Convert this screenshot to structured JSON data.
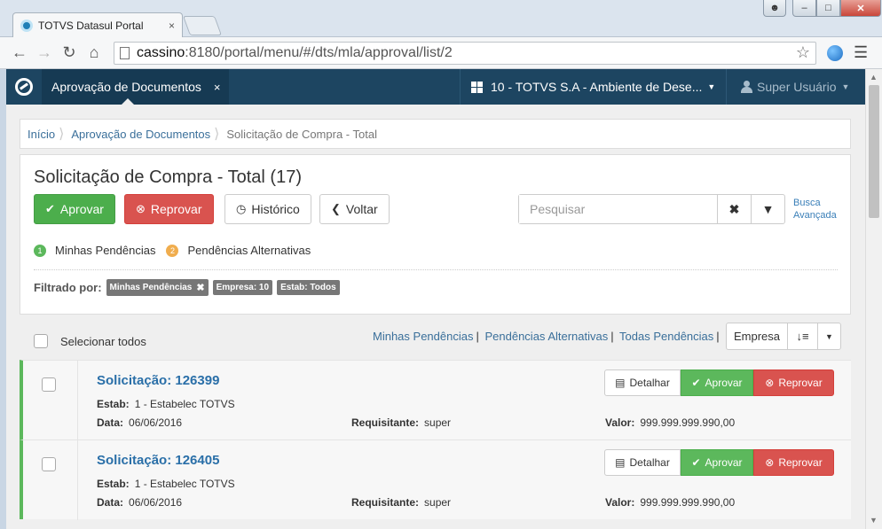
{
  "browser": {
    "tab_title": "TOTVS Datasul Portal",
    "tab_close": "×",
    "url_host": "cassino",
    "url_rest": ":8180/portal/menu/#/dts/mla/approval/list/2"
  },
  "appbar": {
    "active_tab": "Aprovação de Documentos",
    "tab_close": "×",
    "company": "10 - TOTVS S.A - Ambiente de Dese...",
    "user": "Super Usuário"
  },
  "breadcrumb": {
    "items": [
      "Início",
      "Aprovação de Documentos",
      "Solicitação de Compra - Total"
    ]
  },
  "panel": {
    "title": "Solicitação de Compra - Total (17)",
    "buttons": {
      "approve": "Aprovar",
      "reject": "Reprovar",
      "history": "Histórico",
      "back": "Voltar"
    },
    "search_placeholder": "Pesquisar",
    "advanced_search_line1": "Busca",
    "advanced_search_line2": "Avançada",
    "legend": [
      {
        "num": "1",
        "label": "Minhas Pendências"
      },
      {
        "num": "2",
        "label": "Pendências Alternativas"
      }
    ],
    "filter_label": "Filtrado por:",
    "filter_tags": [
      "Minhas Pendências",
      "Empresa: 10",
      "Estab: Todos"
    ]
  },
  "list": {
    "select_all": "Selecionar todos",
    "links": [
      "Minhas Pendências",
      "Pendências Alternativas",
      "Todas Pendências"
    ],
    "sort_by": "Empresa",
    "rows": [
      {
        "title": "Solicitação: 126399",
        "estab_label": "Estab:",
        "estab": "1 - Estabelec TOTVS",
        "date_label": "Data:",
        "date": "06/06/2016",
        "req_label": "Requisitante:",
        "requester": "super",
        "value_label": "Valor:",
        "value": "999.999.999.990,00"
      },
      {
        "title": "Solicitação: 126405",
        "estab_label": "Estab:",
        "estab": "1 - Estabelec TOTVS",
        "date_label": "Data:",
        "date": "06/06/2016",
        "req_label": "Requisitante:",
        "requester": "super",
        "value_label": "Valor:",
        "value": "999.999.999.990,00"
      }
    ],
    "row_actions": {
      "detail": "Detalhar",
      "approve": "Aprovar",
      "reject": "Reprovar"
    }
  },
  "colors": {
    "appbar": "#1d4561",
    "green": "#5cb85c",
    "red": "#d9534f",
    "link": "#2a6fa8"
  }
}
